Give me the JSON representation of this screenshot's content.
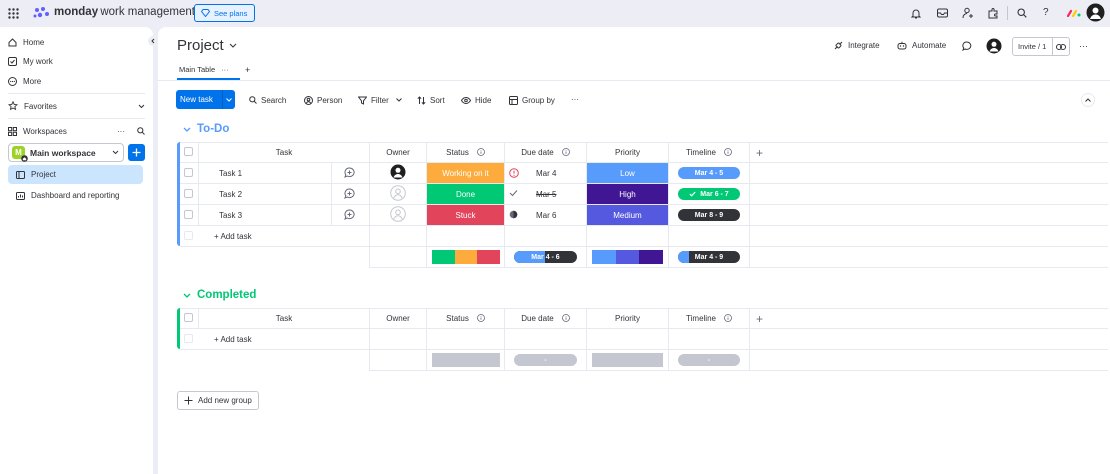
{
  "topbar": {
    "brand_bold": "monday",
    "brand_rest": "work management",
    "see_plans": "See plans"
  },
  "sidebar": {
    "home": "Home",
    "my_work": "My work",
    "more": "More",
    "favorites": "Favorites",
    "workspaces": "Workspaces",
    "workspace_name": "Main workspace",
    "workspace_initial": "M",
    "items": [
      "Project",
      "Dashboard and reporting"
    ]
  },
  "header": {
    "title": "Project",
    "integrate": "Integrate",
    "automate": "Automate",
    "invite": "Invite / 1",
    "view_tab": "Main Table"
  },
  "toolbar": {
    "new_task": "New task",
    "search": "Search",
    "person": "Person",
    "filter": "Filter",
    "sort": "Sort",
    "hide": "Hide",
    "group_by": "Group by"
  },
  "columns": {
    "task": "Task",
    "owner": "Owner",
    "status": "Status",
    "due_date": "Due date",
    "priority": "Priority",
    "timeline": "Timeline"
  },
  "groups": {
    "todo": {
      "title": "To-Do",
      "color": "#579bfc",
      "rows": [
        {
          "task": "Task 1",
          "status": "Working on it",
          "due": "Mar 4",
          "priority": "Low",
          "timeline": "Mar 4 - 5"
        },
        {
          "task": "Task 2",
          "status": "Done",
          "due": "Mar 5",
          "priority": "High",
          "timeline": "Mar 6 - 7"
        },
        {
          "task": "Task 3",
          "status": "Stuck",
          "due": "Mar 6",
          "priority": "Medium",
          "timeline": "Mar 8 - 9"
        }
      ],
      "add_task": "+ Add task",
      "summary_due": "Mar 4 - 6",
      "summary_timeline": "Mar 4 - 9"
    },
    "completed": {
      "title": "Completed",
      "color": "#00c875",
      "add_task": "+ Add task",
      "summary_dash": "-"
    }
  },
  "add_new_group": "Add new group",
  "colors": {
    "working": "#fdab3d",
    "done": "#00c875",
    "stuck": "#e2445c",
    "low": "#579bfc",
    "high": "#401694",
    "medium": "#5559df",
    "primary": "#0073ea"
  }
}
